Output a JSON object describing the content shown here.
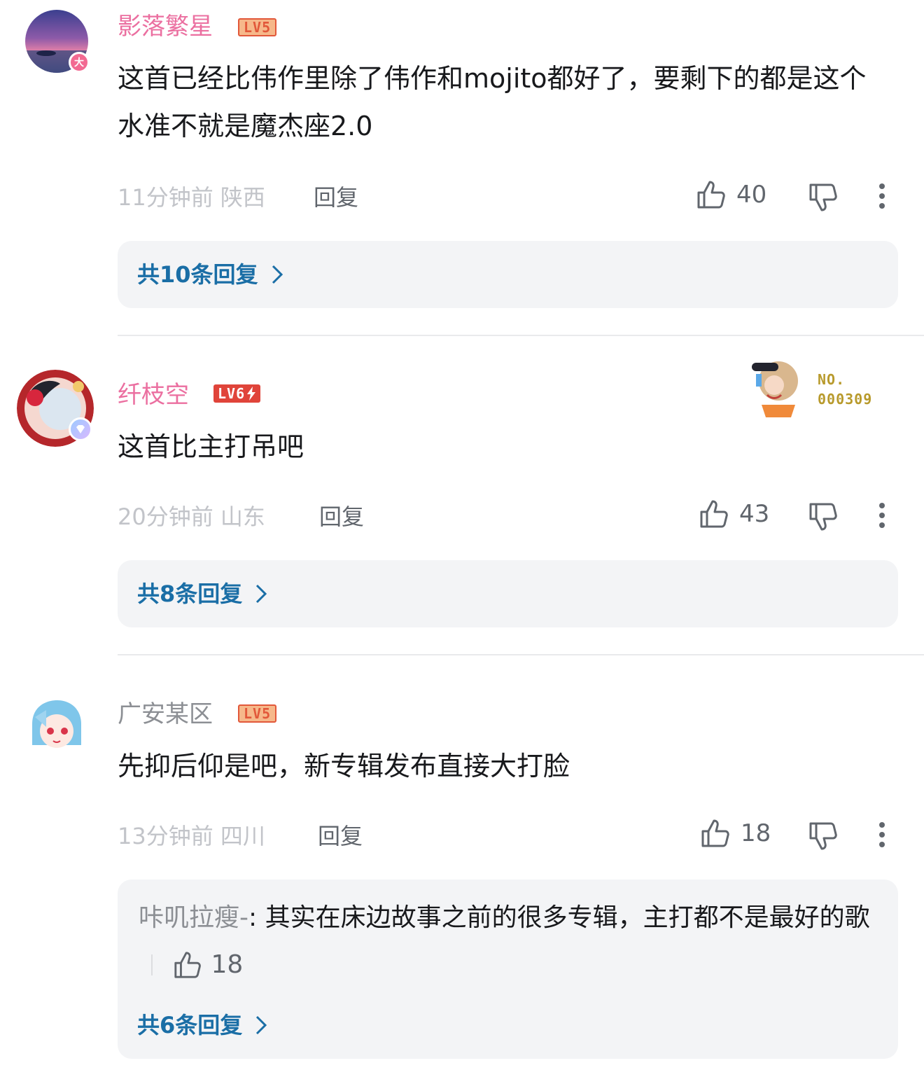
{
  "comments": [
    {
      "username": "影落繁星",
      "level": "LV5",
      "avatar_badge": "大",
      "text": "这首已经比伟作里除了伟作和mojito都好了，要剩下的都是这个水准不就是魔杰座2.0",
      "time_location": "11分钟前 陕西",
      "reply_label": "回复",
      "likes": "40",
      "replies_link": "共10条回复"
    },
    {
      "username": "纤枝空",
      "level": "LV6",
      "nameplate_no": "NO.",
      "nameplate_num": "000309",
      "text": "这首比主打吊吧",
      "time_location": "20分钟前 山东",
      "reply_label": "回复",
      "likes": "43",
      "replies_link": "共8条回复"
    },
    {
      "username": "广安某区",
      "level": "LV5",
      "text": "先抑后仰是吧，新专辑发布直接大打脸",
      "time_location": "13分钟前 四川",
      "reply_label": "回复",
      "likes": "18",
      "sub_reply": {
        "author": "咔叽拉瘦-",
        "separator": ":",
        "text": " 其实在床边故事之前的很多专辑，主打都不是最好的歌",
        "likes": "18"
      },
      "replies_link": "共6条回复"
    }
  ],
  "colors": {
    "username_pink": "#eb6fa0",
    "username_gray": "#8c8f94",
    "link_blue": "#1a6ea6",
    "meta_gray": "#c2c4c9"
  },
  "icons": [
    "thumbs-up-icon",
    "thumbs-down-icon",
    "more-vertical-icon",
    "chevron-right-icon"
  ]
}
